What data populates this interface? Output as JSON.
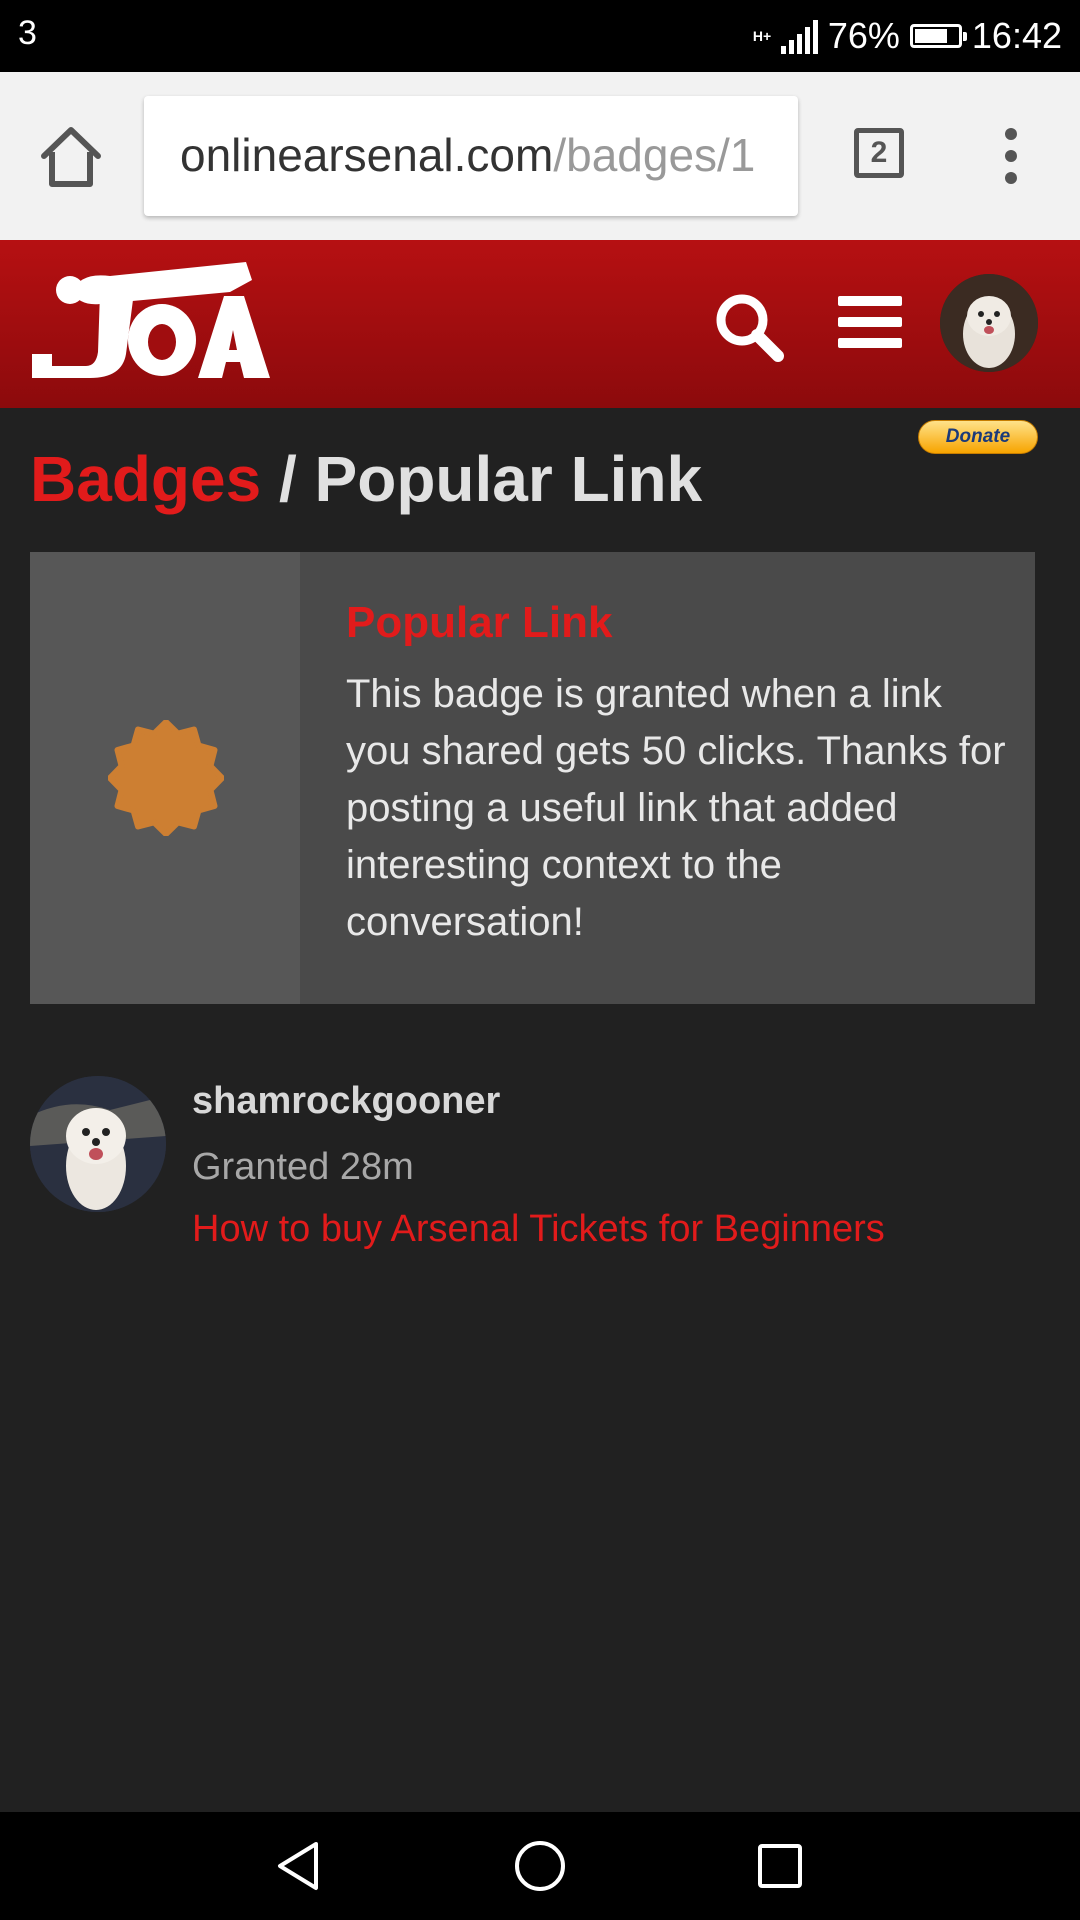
{
  "status_bar": {
    "carrier": "3",
    "network_type": "H+",
    "battery_percent": "76%",
    "battery_level": 0.76,
    "time": "16:42"
  },
  "browser": {
    "url_host": "onlinearsenal.com",
    "url_path": "/badges/1",
    "tab_count": "2",
    "icons": {
      "home": "home-icon",
      "menu": "more-vert-icon"
    }
  },
  "site_header": {
    "logo": "JOA",
    "icons": {
      "search": "search-icon",
      "menu": "hamburger-icon",
      "avatar": "user-avatar"
    },
    "accent_color": "#b61012"
  },
  "donate": {
    "label": "Donate"
  },
  "breadcrumb": {
    "parent": "Badges",
    "separator": "/",
    "current": "Popular Link"
  },
  "badge": {
    "name": "Popular Link",
    "description": "This badge is granted when a link you shared gets 50 clicks. Thanks for posting a useful link that added interesting context to the conversation!",
    "icon": "bronze-badge-icon",
    "icon_color": "#cd7f32"
  },
  "grants": [
    {
      "username": "shamrockgooner",
      "granted": "Granted 28m",
      "topic_link": "How to buy Arsenal Tickets for Beginners"
    }
  ],
  "nav_bar": {
    "icons": [
      "back-icon",
      "home-circle-icon",
      "recents-icon"
    ]
  }
}
